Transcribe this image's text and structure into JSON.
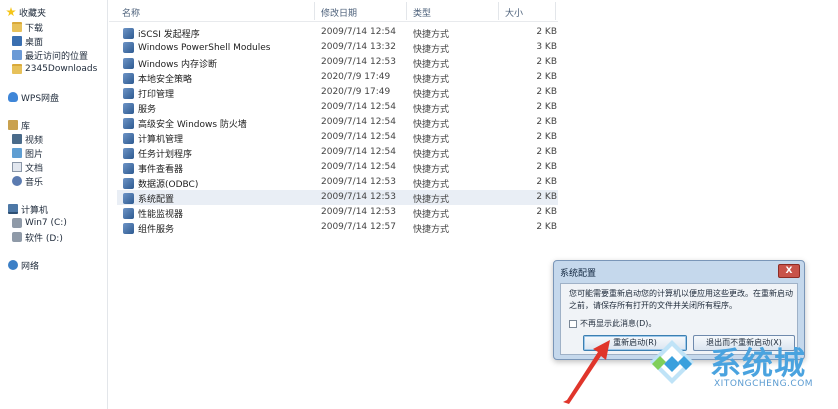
{
  "sidebar": {
    "favorites": {
      "label": "收藏夹"
    },
    "items": [
      {
        "label": "下载"
      },
      {
        "label": "桌面"
      },
      {
        "label": "最近访问的位置"
      },
      {
        "label": "2345Downloads"
      }
    ],
    "wps": {
      "label": "WPS网盘"
    },
    "library": {
      "label": "库"
    },
    "library_items": [
      {
        "label": "视频"
      },
      {
        "label": "图片"
      },
      {
        "label": "文档"
      },
      {
        "label": "音乐"
      }
    ],
    "computer": {
      "label": "计算机"
    },
    "drives": [
      {
        "label": "Win7 (C:)"
      },
      {
        "label": "软件 (D:)"
      }
    ],
    "network": {
      "label": "网络"
    }
  },
  "columns": {
    "name": "名称",
    "date": "修改日期",
    "type": "类型",
    "size": "大小"
  },
  "files": [
    {
      "name": "iSCSI 发起程序",
      "date": "2009/7/14 12:54",
      "type": "快捷方式",
      "size": "2 KB"
    },
    {
      "name": "Windows PowerShell Modules",
      "date": "2009/7/14 13:32",
      "type": "快捷方式",
      "size": "3 KB"
    },
    {
      "name": "Windows 内存诊断",
      "date": "2009/7/14 12:53",
      "type": "快捷方式",
      "size": "2 KB"
    },
    {
      "name": "本地安全策略",
      "date": "2020/7/9 17:49",
      "type": "快捷方式",
      "size": "2 KB"
    },
    {
      "name": "打印管理",
      "date": "2020/7/9 17:49",
      "type": "快捷方式",
      "size": "2 KB"
    },
    {
      "name": "服务",
      "date": "2009/7/14 12:54",
      "type": "快捷方式",
      "size": "2 KB"
    },
    {
      "name": "高级安全 Windows 防火墙",
      "date": "2009/7/14 12:54",
      "type": "快捷方式",
      "size": "2 KB"
    },
    {
      "name": "计算机管理",
      "date": "2009/7/14 12:54",
      "type": "快捷方式",
      "size": "2 KB"
    },
    {
      "name": "任务计划程序",
      "date": "2009/7/14 12:54",
      "type": "快捷方式",
      "size": "2 KB"
    },
    {
      "name": "事件查看器",
      "date": "2009/7/14 12:54",
      "type": "快捷方式",
      "size": "2 KB"
    },
    {
      "name": "数据源(ODBC)",
      "date": "2009/7/14 12:53",
      "type": "快捷方式",
      "size": "2 KB"
    },
    {
      "name": "系统配置",
      "date": "2009/7/14 12:53",
      "type": "快捷方式",
      "size": "2 KB"
    },
    {
      "name": "性能监视器",
      "date": "2009/7/14 12:53",
      "type": "快捷方式",
      "size": "2 KB"
    },
    {
      "name": "组件服务",
      "date": "2009/7/14 12:57",
      "type": "快捷方式",
      "size": "2 KB"
    }
  ],
  "dialog": {
    "title": "系统配置",
    "close_label": "X",
    "message": "您可能需要重新启动您的计算机以便应用这些更改。在重新启动之前，请保存所有打开的文件并关闭所有程序。",
    "checkbox_label": "不再显示此消息(D)。",
    "restart_label": "重新启动(R)",
    "exit_label": "退出而不重新启动(X)"
  },
  "watermark": {
    "logo_text": "系统城",
    "site": "XITONGCHENG.COM"
  },
  "colors": {
    "accent": "#3c7fb1",
    "selected_row": "#e9eef5",
    "arrow": "#e0352b",
    "watermark": "#4aa3df"
  }
}
